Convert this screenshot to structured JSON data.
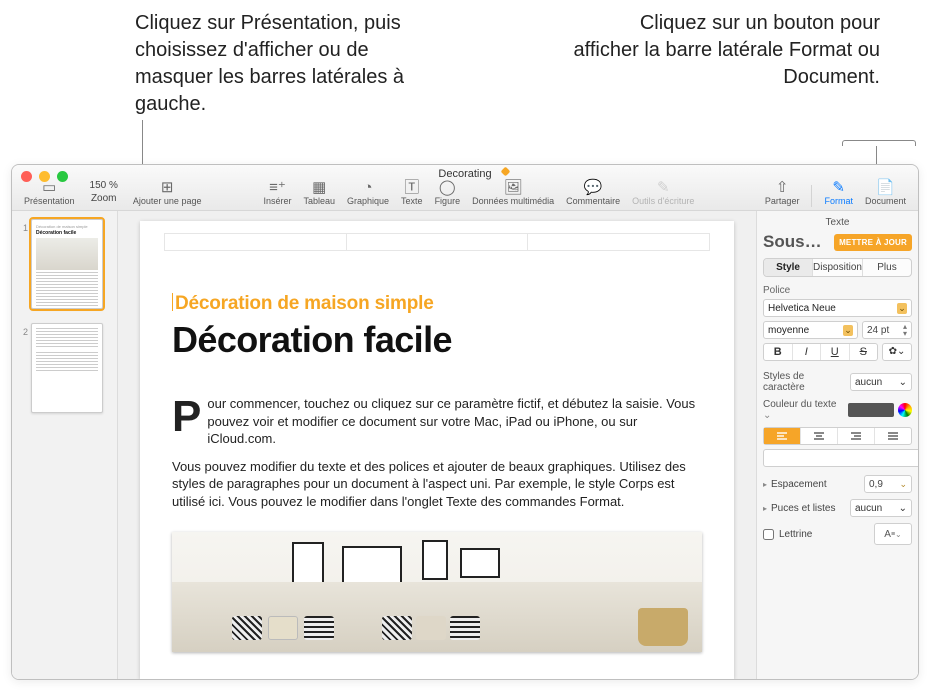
{
  "callouts": {
    "left": "Cliquez sur Présentation, puis choisissez d'afficher ou de masquer les barres latérales à gauche.",
    "right": "Cliquez sur un bouton pour afficher la barre latérale Format ou Document."
  },
  "window": {
    "title": "Decorating"
  },
  "toolbar": {
    "presentation": "Présentation",
    "zoom_value": "150 %",
    "zoom_label": "Zoom",
    "add_page": "Ajouter une page",
    "insert": "Insérer",
    "table": "Tableau",
    "chart": "Graphique",
    "text": "Texte",
    "shape": "Figure",
    "media": "Données multimédia",
    "comment": "Commentaire",
    "writing_tools": "Outils d'écriture",
    "share": "Partager",
    "format": "Format",
    "document": "Document"
  },
  "thumbs": {
    "n1": "1",
    "n2": "2"
  },
  "doc": {
    "subtitle": "Décoration de maison simple",
    "headline": "Décoration facile",
    "p1": "our commencer, touchez ou cliquez sur ce paramètre fictif, et débutez la saisie. Vous pouvez voir et modifier ce document sur votre Mac, iPad ou iPhone, ou sur iCloud.com.",
    "p2": "Vous pouvez modifier du texte et des polices et ajouter de beaux graphiques. Utilisez des styles de paragraphes pour un document à l'aspect uni. Par exemple, le style Corps est utilisé ici. Vous pouvez le modifier dans l'onglet Texte des commandes Format.",
    "dropcap": "P"
  },
  "inspector": {
    "title": "Texte",
    "style_name": "Sous…*",
    "update": "METTRE À JOUR",
    "tabs": {
      "style": "Style",
      "layout": "Disposition",
      "more": "Plus"
    },
    "font_section": "Police",
    "font_family": "Helvetica Neue",
    "font_weight": "moyenne",
    "font_size": "24 pt",
    "bius": {
      "b": "B",
      "i": "I",
      "u": "U",
      "s": "S"
    },
    "char_styles": "Styles de caractère",
    "char_value": "aucun",
    "text_color": "Couleur du texte",
    "spacing": "Espacement",
    "spacing_val": "0,9",
    "bullets": "Puces et listes",
    "bullets_val": "aucun",
    "lettrine": "Lettrine",
    "lettrine_glyph": "A"
  }
}
